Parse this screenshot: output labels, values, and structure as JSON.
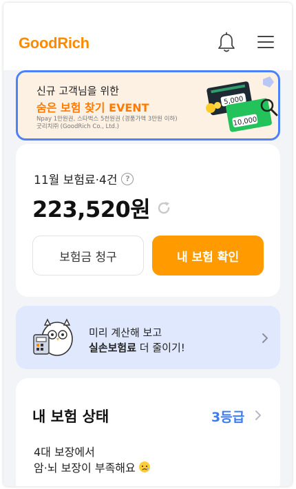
{
  "header": {
    "logo": "GoodRich",
    "icons": [
      "bell-icon",
      "menu-icon"
    ]
  },
  "banner": {
    "line1": "신규 고객님을 위한",
    "line2": "숨은 보험 찾기 EVENT",
    "note1": "Npay 1만원권, 스타벅스 5천원권 (경품가액 3만원 이하)",
    "note2": "굿리치㈜ (GoodRich Co., Ltd.)",
    "card1_value": "5,000",
    "card2_value": "10,000",
    "accent": "#ff7a00",
    "border": "#4c82f7"
  },
  "premium": {
    "label": "11월 보험료·4건",
    "help": "?",
    "amount": "223,520원",
    "claim_button": "보험금 청구",
    "check_button": "내 보험 확인",
    "primary_color": "#ff9a00"
  },
  "promo": {
    "line1": "미리 계산해 보고",
    "line2_bold": "실손보험료",
    "line2_rest": " 더 줄이기!"
  },
  "status": {
    "title": "내 보험 상태",
    "grade": "3등급",
    "desc1": "4대 보장에서",
    "desc2": "암·뇌 보장이 부족해요",
    "grade_color": "#3d7af5"
  }
}
